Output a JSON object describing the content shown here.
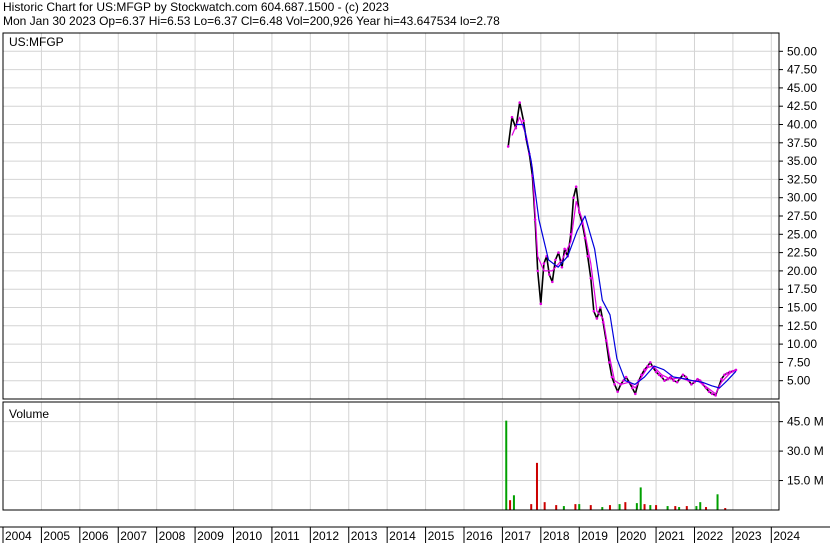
{
  "header": {
    "line1": "Historic Chart for US:MFGP by Stockwatch.com 604.687.1500 - (c) 2023",
    "line2": "Mon Jan 30 2023  Op=6.37  Hi=6.53  Lo=6.37  Cl=6.48  Vol=200,926  Year hi=43.647534  lo=2.78"
  },
  "price_panel": {
    "label": "US:MFGP"
  },
  "volume_panel": {
    "label": "Volume"
  },
  "colors": {
    "grid": "#d4d4d4",
    "price_bar": "#000000",
    "moving_avg_short": "#e000e0",
    "moving_avg_long": "#0000dd",
    "volume_up": "#00a000",
    "volume_down": "#cc0000",
    "panel_border": "#000000"
  },
  "chart_data": [
    {
      "type": "line",
      "title": "US:MFGP",
      "y_tick_labels": [
        "50.00",
        "47.50",
        "45.00",
        "42.50",
        "40.00",
        "37.50",
        "35.00",
        "32.50",
        "30.00",
        "27.50",
        "25.00",
        "22.50",
        "20.00",
        "17.50",
        "15.00",
        "12.50",
        "10.00",
        "7.50",
        "5.00"
      ],
      "ylim": [
        2.5,
        52.5
      ],
      "x_tick_labels": [
        "2004",
        "2005",
        "2006",
        "2007",
        "2008",
        "2009",
        "2010",
        "2011",
        "2012",
        "2013",
        "2014",
        "2015",
        "2016",
        "2017",
        "2018",
        "2019",
        "2020",
        "2021",
        "2022",
        "2023",
        "2024"
      ],
      "xlim": [
        2004.0,
        2024.2
      ],
      "grid": true,
      "series": [
        {
          "style": "price",
          "x": [
            2017.15,
            2017.25,
            2017.35,
            2017.45,
            2017.55,
            2017.62,
            2017.7,
            2017.78,
            2017.85,
            2017.92,
            2018.0,
            2018.08,
            2018.15,
            2018.22,
            2018.3,
            2018.38,
            2018.46,
            2018.55,
            2018.62,
            2018.7,
            2018.78,
            2018.85,
            2018.92,
            2019.0,
            2019.08,
            2019.15,
            2019.22,
            2019.3,
            2019.38,
            2019.46,
            2019.55,
            2019.62,
            2019.7,
            2019.78,
            2019.85,
            2019.92,
            2020.0,
            2020.08,
            2020.15,
            2020.22,
            2020.3,
            2020.38,
            2020.46,
            2020.55,
            2020.62,
            2020.7,
            2020.78,
            2020.85,
            2020.92,
            2021.0,
            2021.08,
            2021.15,
            2021.22,
            2021.3,
            2021.38,
            2021.46,
            2021.55,
            2021.62,
            2021.7,
            2021.78,
            2021.85,
            2021.92,
            2022.0,
            2022.08,
            2022.15,
            2022.22,
            2022.3,
            2022.38,
            2022.46,
            2022.55,
            2022.62,
            2022.7,
            2022.78,
            2022.85,
            2022.92,
            2023.0,
            2023.08
          ],
          "y": [
            37.0,
            41.0,
            39.5,
            43.0,
            40.5,
            38.0,
            36.0,
            33.0,
            27.0,
            20.0,
            15.5,
            21.0,
            22.0,
            19.5,
            18.5,
            21.5,
            22.5,
            20.5,
            23.0,
            22.0,
            25.0,
            30.0,
            31.5,
            28.0,
            26.5,
            24.5,
            22.0,
            19.0,
            14.5,
            13.5,
            15.0,
            13.0,
            10.5,
            7.5,
            5.5,
            4.5,
            3.5,
            4.5,
            5.0,
            5.5,
            4.8,
            4.0,
            3.2,
            5.0,
            5.8,
            6.5,
            7.0,
            7.5,
            6.8,
            6.2,
            5.8,
            5.5,
            5.0,
            5.2,
            5.5,
            5.0,
            4.8,
            5.3,
            5.8,
            5.5,
            5.0,
            4.5,
            4.8,
            5.2,
            5.0,
            4.5,
            4.0,
            3.5,
            3.2,
            3.0,
            4.0,
            5.2,
            5.8,
            6.0,
            6.2,
            6.3,
            6.48
          ]
        },
        {
          "style": "ma_short",
          "x": [
            2017.25,
            2017.45,
            2017.62,
            2017.78,
            2017.92,
            2018.08,
            2018.3,
            2018.55,
            2018.78,
            2018.92,
            2019.08,
            2019.3,
            2019.46,
            2019.62,
            2019.78,
            2019.92,
            2020.08,
            2020.3,
            2020.46,
            2020.62,
            2020.78,
            2020.92,
            2021.15,
            2021.38,
            2021.62,
            2021.85,
            2022.08,
            2022.3,
            2022.55,
            2022.7,
            2022.92,
            2023.08
          ],
          "y": [
            38.5,
            41.0,
            38.5,
            34.0,
            22.0,
            20.0,
            20.0,
            21.5,
            24.0,
            29.5,
            27.0,
            21.0,
            14.5,
            13.5,
            8.5,
            5.0,
            4.5,
            4.8,
            4.0,
            5.5,
            6.8,
            7.0,
            5.8,
            5.2,
            5.4,
            5.0,
            5.0,
            4.2,
            3.2,
            4.8,
            6.0,
            6.5
          ]
        },
        {
          "style": "ma_long",
          "x": [
            2017.35,
            2017.55,
            2017.75,
            2017.95,
            2018.2,
            2018.45,
            2018.7,
            2018.95,
            2019.15,
            2019.4,
            2019.6,
            2019.8,
            2019.98,
            2020.2,
            2020.45,
            2020.7,
            2020.95,
            2021.2,
            2021.45,
            2021.7,
            2021.95,
            2022.2,
            2022.45,
            2022.65,
            2022.85,
            2023.08
          ],
          "y": [
            40.0,
            40.0,
            35.0,
            27.0,
            21.5,
            20.5,
            22.0,
            25.5,
            27.5,
            23.0,
            16.0,
            14.0,
            8.0,
            5.0,
            4.5,
            5.5,
            7.0,
            6.5,
            5.5,
            5.3,
            5.0,
            4.8,
            4.3,
            4.0,
            5.0,
            6.3
          ]
        }
      ]
    },
    {
      "type": "bar",
      "title": "Volume",
      "y_tick_labels": [
        "45.0 M",
        "30.0 M",
        "15.0 M"
      ],
      "ylim": [
        0,
        55
      ],
      "xlim": [
        2004.0,
        2024.2
      ],
      "grid": true,
      "series": [
        {
          "name": "up",
          "x": [
            2017.1,
            2017.3,
            2018.6,
            2019.0,
            2019.6,
            2020.05,
            2020.5,
            2020.6,
            2020.85,
            2021.3,
            2021.6,
            2022.05,
            2022.15,
            2022.6
          ],
          "values": [
            45.5,
            7.5,
            2.0,
            3.0,
            1.5,
            3.0,
            3.5,
            11.5,
            2.5,
            2.0,
            1.5,
            2.0,
            4.0,
            8.0
          ]
        },
        {
          "name": "down",
          "x": [
            2017.2,
            2017.75,
            2017.9,
            2018.1,
            2018.4,
            2018.9,
            2019.3,
            2019.8,
            2020.2,
            2020.7,
            2021.0,
            2021.5,
            2021.8,
            2022.3,
            2022.8
          ],
          "values": [
            5.0,
            3.0,
            24.0,
            4.0,
            2.5,
            3.0,
            2.5,
            2.5,
            4.0,
            3.0,
            2.5,
            2.0,
            2.0,
            1.5,
            1.0
          ]
        }
      ]
    }
  ]
}
